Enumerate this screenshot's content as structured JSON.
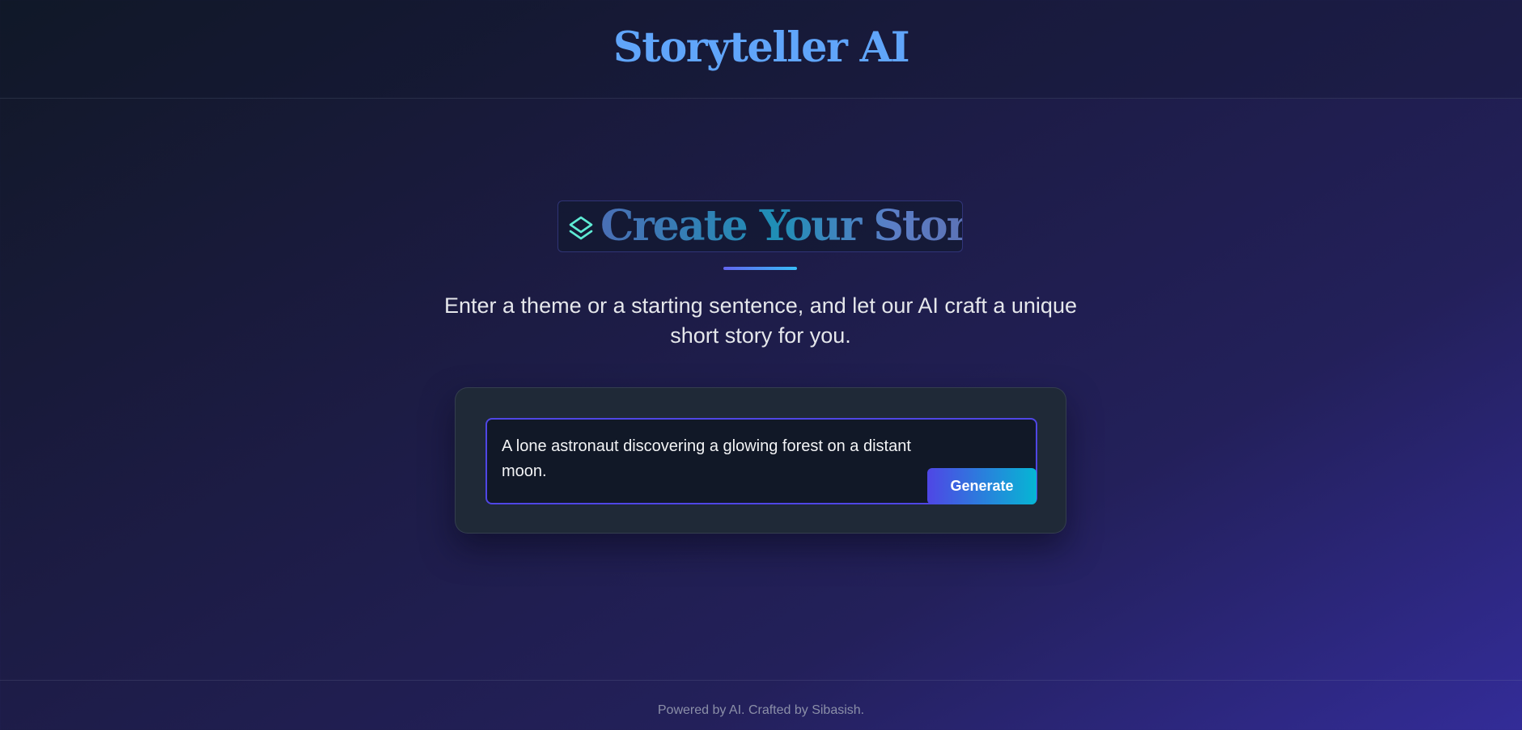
{
  "header": {
    "title": "Storyteller AI"
  },
  "hero": {
    "icon": "layers-icon",
    "title": "Create Your Story",
    "subtitle": "Enter a theme or a starting sentence, and let our AI craft a unique short story for you."
  },
  "form": {
    "input_value": "A lone astronaut discovering a glowing forest on a distant moon.",
    "generate_label": "Generate"
  },
  "footer": {
    "text": "Powered by AI. Crafted by Sibasish."
  },
  "colors": {
    "accent_indigo": "#4f46e5",
    "accent_cyan": "#06b6d4",
    "title_blue": "#60a5fa",
    "card_bg": "#1f2937"
  }
}
